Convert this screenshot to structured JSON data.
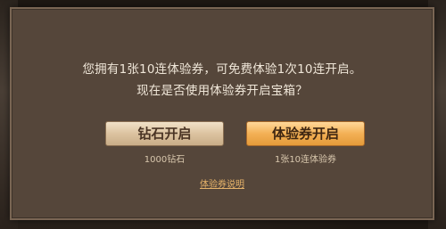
{
  "dialog": {
    "message_line1": "您拥有1张10连体验券，可免费体验1次10连开启。",
    "message_line2": "现在是否使用体验券开启宝箱？"
  },
  "buttons": {
    "diamond_open_label": "钻石开启",
    "diamond_cost": "1000钻石",
    "voucher_open_label": "体验券开启",
    "voucher_cost": "1张10连体验券"
  },
  "links": {
    "voucher_info": "体验券说明"
  }
}
